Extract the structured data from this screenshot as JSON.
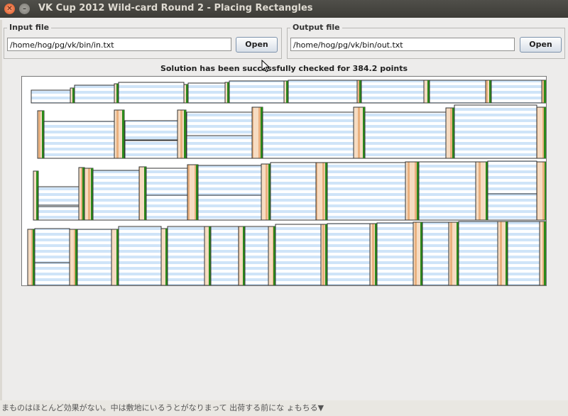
{
  "window": {
    "title": "VK Cup 2012 Wild-card Round 2 - Placing Rectangles"
  },
  "input": {
    "label": "Input file",
    "value": "/home/hog/pg/vk/bin/in.txt",
    "button": "Open"
  },
  "output": {
    "label": "Output file",
    "value": "/home/hog/pg/vk/bin/out.txt",
    "button": "Open"
  },
  "status": "Solution has been successfully checked for 384.2 points",
  "background_text": "まものはほとんど効果がない。中は敷地にいるうとがなりまって 出荷する前にな ょもちる▼",
  "colors": {
    "rect_border": "#333333",
    "rect_stripe_a": "#ffffff",
    "rect_stripe_b": "#cfe4f8",
    "bar_fill": "#f6dcc2",
    "bar_stripe": "#e9b07e",
    "bar_edge": "#2b8a1a"
  },
  "icons": {
    "close": "close-icon",
    "minimize": "minimize-icon",
    "cursor": "mouse-cursor-icon"
  }
}
